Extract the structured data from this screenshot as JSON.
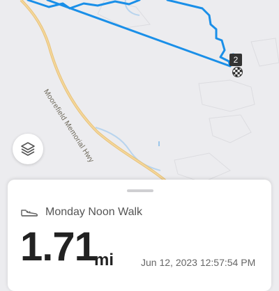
{
  "map": {
    "road_label": "Moorefield Memorial Hwy",
    "route_color": "#1a8fe8",
    "finish_marker": {
      "lap": "2",
      "icon": "checkered-flag-icon"
    },
    "layers_icon": "layers-icon"
  },
  "activity": {
    "type_icon": "shoe-icon",
    "title": "Monday Noon Walk",
    "distance": "1.71",
    "unit": "mi",
    "timestamp": "Jun 12, 2023 12:57:54 PM"
  }
}
